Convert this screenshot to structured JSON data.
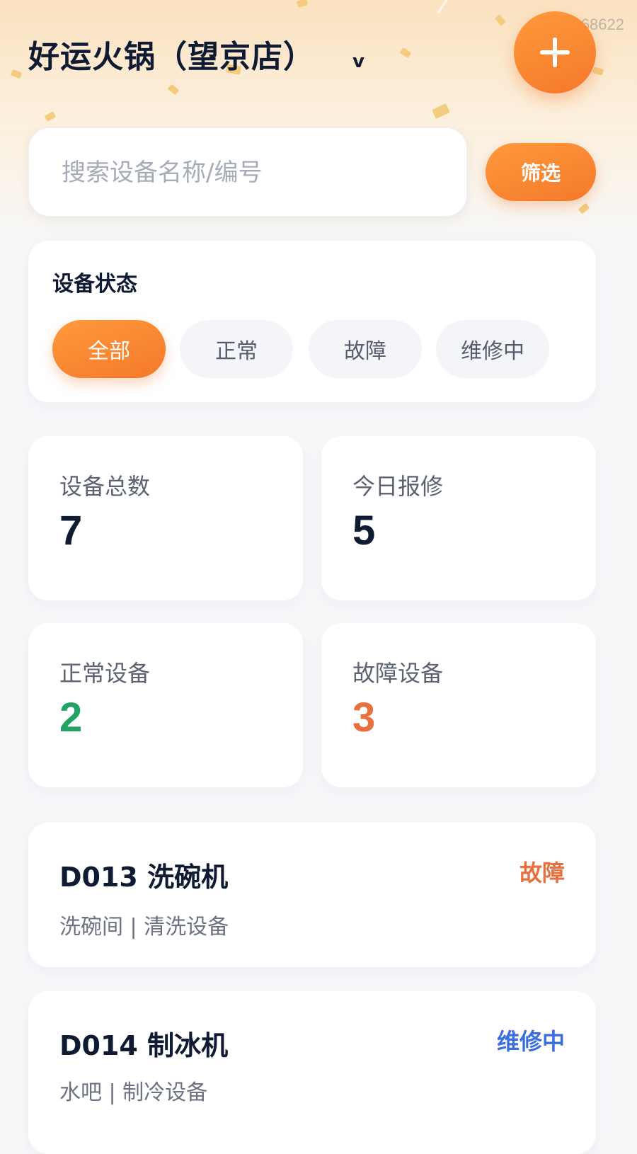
{
  "header": {
    "store_name": "好运火锅（望京店）",
    "dropdown_glyph": "v",
    "watermark": "ID:868622"
  },
  "search": {
    "placeholder": "搜索设备名称/编号",
    "filter_label": "筛选"
  },
  "status_filter": {
    "title": "设备状态",
    "options": [
      "全部",
      "正常",
      "故障",
      "维修中"
    ],
    "selected": "全部"
  },
  "stats": [
    {
      "label": "设备总数",
      "value": "7"
    },
    {
      "label": "今日报修",
      "value": "5"
    },
    {
      "label": "正常设备",
      "value": "2"
    },
    {
      "label": "故障设备",
      "value": "3"
    }
  ],
  "devices": [
    {
      "title": "D013 洗碗机",
      "subtitle": "洗碗间 | 清洗设备",
      "status": "故障"
    },
    {
      "title": "D014 制冰机",
      "subtitle": "水吧 | 制冷设备",
      "status": "维修中"
    }
  ],
  "colors": {
    "accent": "#f4782a",
    "normal": "#21a366",
    "fault": "#e8703f",
    "repairing": "#3c6ee0"
  }
}
